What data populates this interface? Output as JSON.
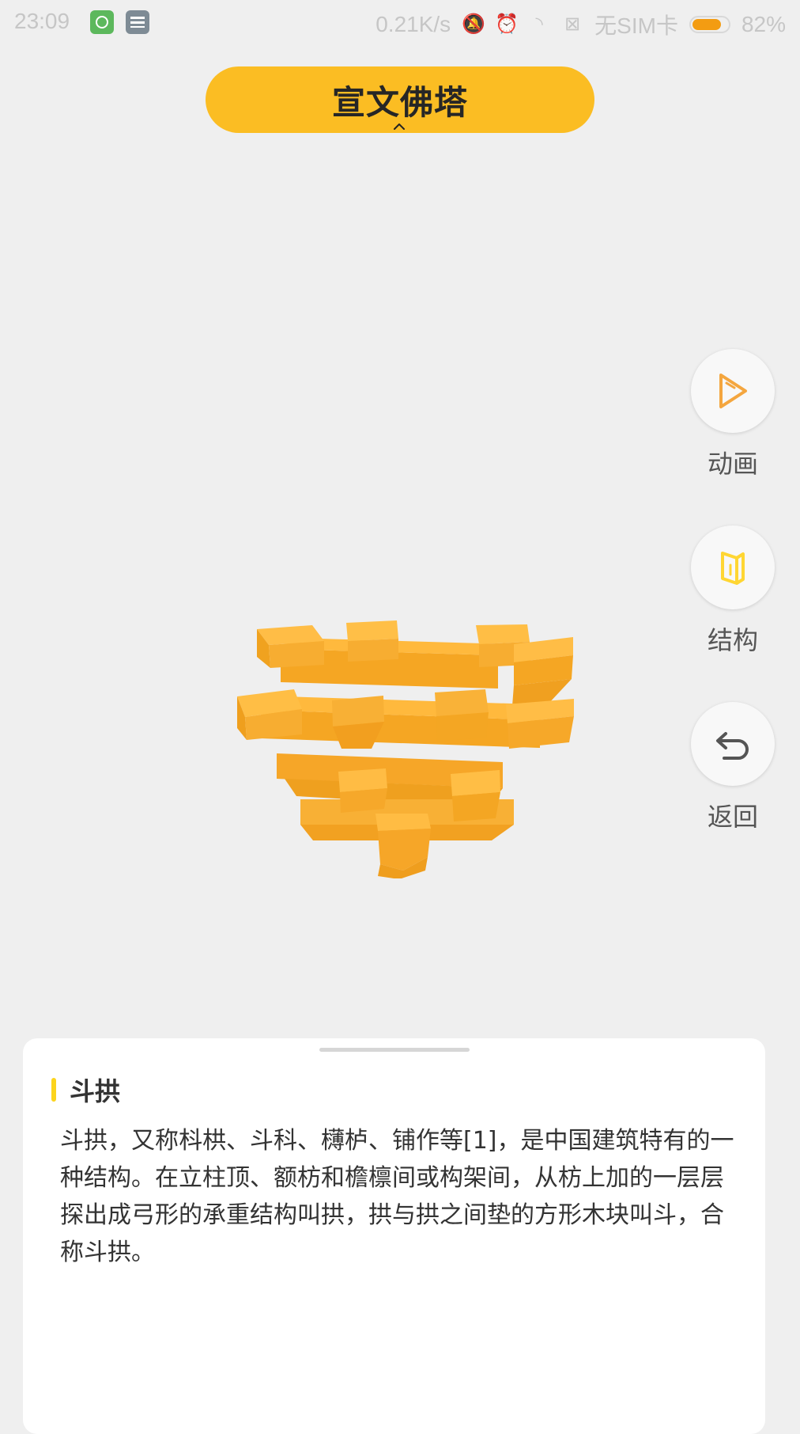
{
  "status_bar": {
    "time": "23:09",
    "network_speed": "0.21K/s",
    "sim_status": "无SIM卡",
    "battery_percent": "82%",
    "battery_level": 0.82,
    "icons": [
      "app-green-icon",
      "app-gray-icon",
      "mute-bell-icon",
      "alarm-icon",
      "wifi-icon",
      "no-signal-icon",
      "battery-icon"
    ]
  },
  "title": "宣文佛塔",
  "side_actions": [
    {
      "label": "动画",
      "icon": "play-icon"
    },
    {
      "label": "结构",
      "icon": "structure-icon"
    },
    {
      "label": "返回",
      "icon": "undo-icon"
    }
  ],
  "model": {
    "subject": "dougong-model",
    "color": "#f7b52a"
  },
  "sheet": {
    "heading": "斗拱",
    "body": "斗拱，又称枓栱、斗科、欂栌、铺作等[1]，是中国建筑特有的一种结构。在立柱顶、额枋和檐檩间或构架间，从枋上加的一层层探出成弓形的承重结构叫拱，拱与拱之间垫的方形木块叫斗，合称斗拱。"
  },
  "colors": {
    "accent": "#fbbd23",
    "play_icon": "#f4a63f",
    "structure_icon": "#ffd633",
    "undo_icon": "#555555",
    "background": "#efefef"
  }
}
